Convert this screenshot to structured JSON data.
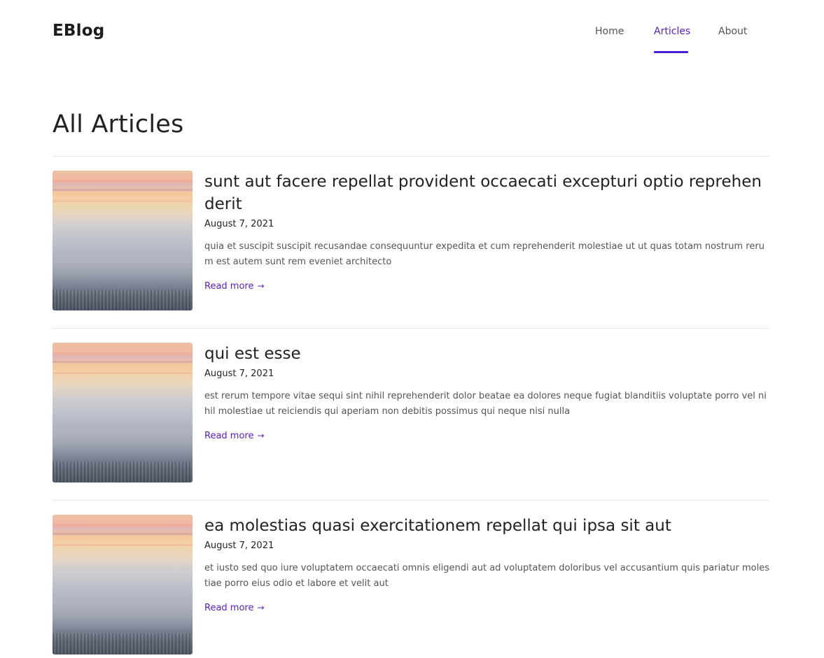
{
  "brand": {
    "name": "EBlog",
    "accent": "#4c1dd8"
  },
  "nav": {
    "items": [
      {
        "label": "Home",
        "active": false
      },
      {
        "label": "Articles",
        "active": true
      },
      {
        "label": "About",
        "active": false
      }
    ]
  },
  "page": {
    "title": "All Articles"
  },
  "articles": [
    {
      "title": "sunt aut facere repellat provident occaecati excepturi optio reprehenderit",
      "date": "August 7, 2021",
      "excerpt": "quia et suscipit suscipit recusandae consequuntur expedita et cum reprehenderit molestiae ut ut quas totam nostrum rerum est autem sunt rem eveniet architecto",
      "read_more": "Read more",
      "arrow": "→"
    },
    {
      "title": "qui est esse",
      "date": "August 7, 2021",
      "excerpt": "est rerum tempore vitae sequi sint nihil reprehenderit dolor beatae ea dolores neque fugiat blanditiis voluptate porro vel nihil molestiae ut reiciendis qui aperiam non debitis possimus qui neque nisi nulla",
      "read_more": "Read more",
      "arrow": "→"
    },
    {
      "title": "ea molestias quasi exercitationem repellat qui ipsa sit aut",
      "date": "August 7, 2021",
      "excerpt": "et iusto sed quo iure voluptatem occaecati omnis eligendi aut ad voluptatem doloribus vel accusantium quis pariatur molestiae porro eius odio et labore et velit aut",
      "read_more": "Read more",
      "arrow": "→"
    }
  ]
}
